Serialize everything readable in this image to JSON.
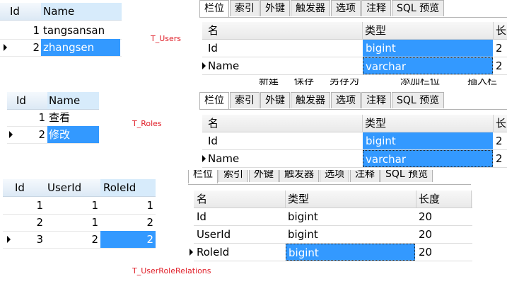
{
  "users_grid": {
    "columns": [
      "Id",
      "Name"
    ],
    "rows": [
      [
        "1",
        "tangsansan"
      ],
      [
        "2",
        "zhangsen"
      ]
    ]
  },
  "users_label": "T_Users",
  "roles_grid": {
    "columns": [
      "Id",
      "Name"
    ],
    "rows": [
      [
        "1",
        "查看"
      ],
      [
        "2",
        "修改"
      ]
    ]
  },
  "roles_label": "T_Roles",
  "relations_grid": {
    "columns": [
      "Id",
      "UserId",
      "RoleId"
    ],
    "rows": [
      [
        "1",
        "1",
        "1"
      ],
      [
        "2",
        "1",
        "2"
      ],
      [
        "3",
        "2",
        "2"
      ]
    ]
  },
  "relations_label": "T_UserRoleRelations",
  "designer_tabs": [
    "栏位",
    "索引",
    "外键",
    "触发器",
    "选项",
    "注释",
    "SQL 预览"
  ],
  "designer1": {
    "headers": [
      "名",
      "类型",
      "长"
    ],
    "rows": [
      [
        "Id",
        "bigint",
        "2"
      ],
      [
        "Name",
        "varchar",
        "2"
      ]
    ]
  },
  "toolbar_partial": [
    "新建",
    "保存",
    "另存为",
    "添加栏位",
    "插入栏"
  ],
  "designer2": {
    "headers": [
      "名",
      "类型",
      "长"
    ],
    "rows": [
      [
        "Id",
        "bigint",
        "2"
      ],
      [
        "Name",
        "varchar",
        "2"
      ]
    ]
  },
  "designer3": {
    "headers": [
      "名",
      "类型",
      "长度"
    ],
    "rows": [
      [
        "Id",
        "bigint",
        "20"
      ],
      [
        "UserId",
        "bigint",
        "20"
      ],
      [
        "RoleId",
        "bigint",
        "20"
      ]
    ]
  }
}
